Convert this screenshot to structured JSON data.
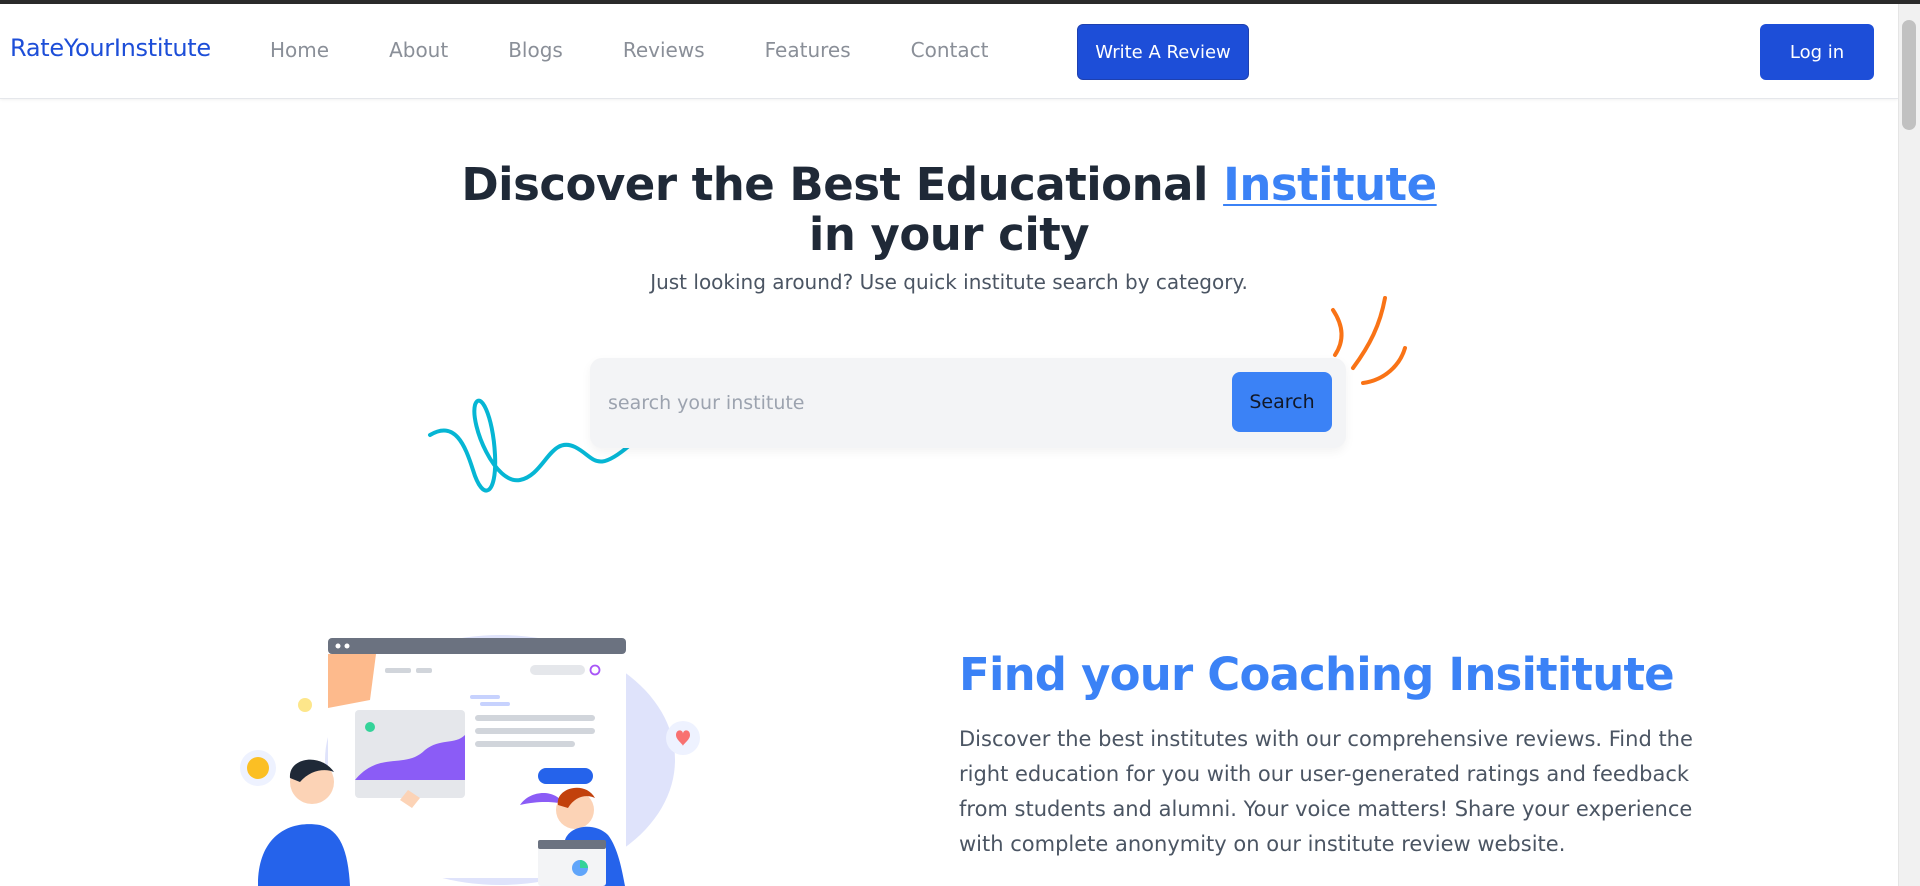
{
  "brand": "RateYourInstitute",
  "nav": {
    "links": [
      "Home",
      "About",
      "Blogs",
      "Reviews",
      "Features",
      "Contact"
    ],
    "write_review": "Write A Review",
    "login": "Log in"
  },
  "hero": {
    "title_part1": "Discover the Best Educational ",
    "title_accent": "Institute",
    "title_part2": "in your city",
    "subtitle": "Just looking around? Use quick institute search by category."
  },
  "search": {
    "placeholder": "search your institute",
    "button": "Search"
  },
  "feature": {
    "title": "Find your Coaching Insititute",
    "text": "Discover the best institutes with our comprehensive reviews. Find the right education for you with our user-generated ratings and feedback from students and alumni. Your voice matters! Share your experience with complete anonymity on our institute review website."
  },
  "colors": {
    "brand": "#1d4ed8",
    "accent": "#3b82f6",
    "squiggle_teal": "#06b6d4",
    "squiggle_orange": "#f97316"
  }
}
